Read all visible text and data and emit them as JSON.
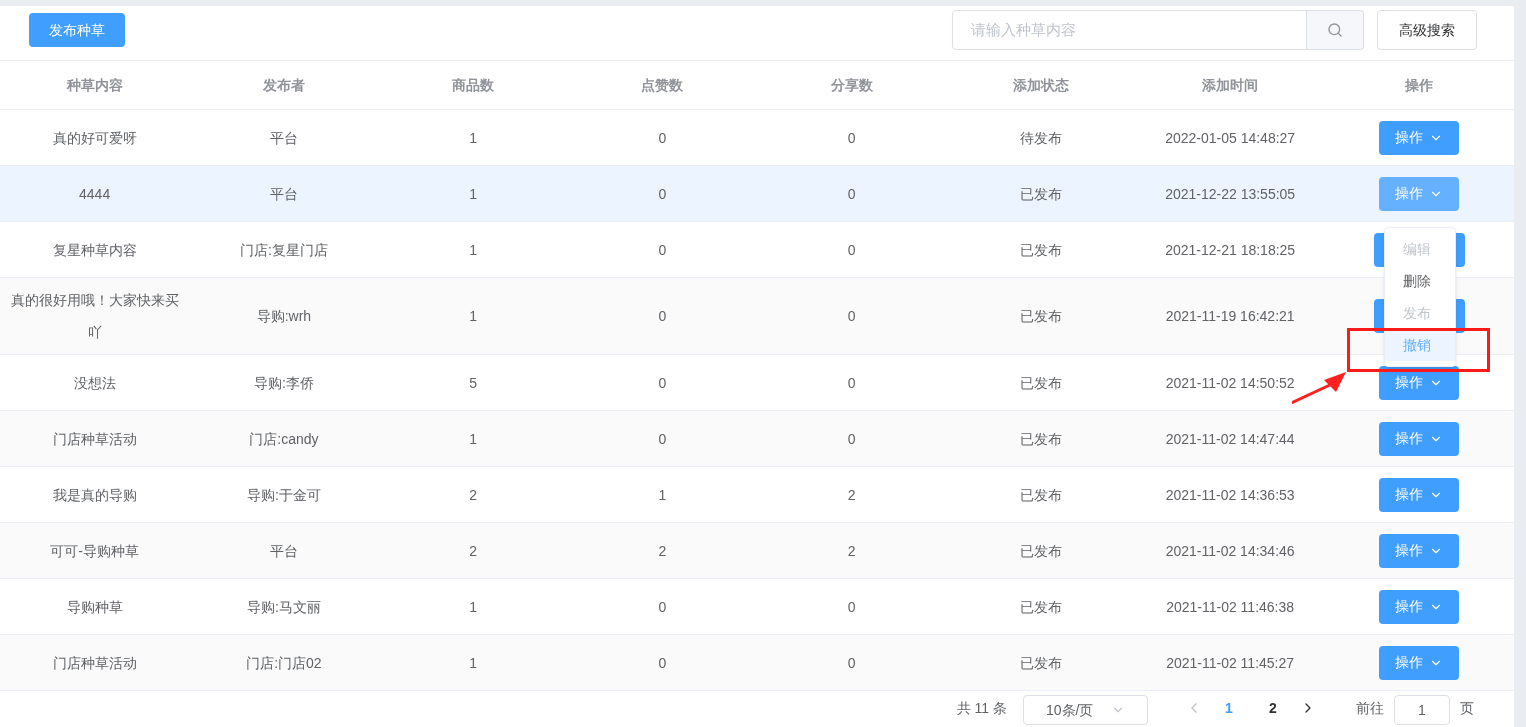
{
  "toolbar": {
    "publish_button": "发布种草",
    "search": {
      "placeholder": "请输入种草内容"
    },
    "advanced_button": "高级搜索"
  },
  "table": {
    "columns": [
      "种草内容",
      "发布者",
      "商品数",
      "点赞数",
      "分享数",
      "添加状态",
      "添加时间",
      "操作"
    ],
    "rows": [
      {
        "content": "真的好可爱呀",
        "publisher": "平台",
        "products": "1",
        "likes": "0",
        "shares": "0",
        "status": "待发布",
        "time": "2022-01-05 14:48:27",
        "action": "操作",
        "hovered": false
      },
      {
        "content": "4444",
        "publisher": "平台",
        "products": "1",
        "likes": "0",
        "shares": "0",
        "status": "已发布",
        "time": "2021-12-22 13:55:05",
        "action": "操作",
        "hovered": true
      },
      {
        "content": "复星种草内容",
        "publisher": "门店:复星门店",
        "products": "1",
        "likes": "0",
        "shares": "0",
        "status": "已发布",
        "time": "2021-12-21 18:18:25",
        "hovered": false
      },
      {
        "content": "真的很好用哦！大家快来买吖",
        "publisher": "导购:wrh",
        "products": "1",
        "likes": "0",
        "shares": "0",
        "status": "已发布",
        "time": "2021-11-19 16:42:21",
        "hovered": false
      },
      {
        "content": "没想法",
        "publisher": "导购:李侨",
        "products": "5",
        "likes": "0",
        "shares": "0",
        "status": "已发布",
        "time": "2021-11-02 14:50:52",
        "action": "操作",
        "hovered": false
      },
      {
        "content": "门店种草活动",
        "publisher": "门店:candy",
        "products": "1",
        "likes": "0",
        "shares": "0",
        "status": "已发布",
        "time": "2021-11-02 14:47:44",
        "action": "操作",
        "hovered": false
      },
      {
        "content": "我是真的导购",
        "publisher": "导购:于金可",
        "products": "2",
        "likes": "1",
        "shares": "2",
        "status": "已发布",
        "time": "2021-11-02 14:36:53",
        "action": "操作",
        "hovered": false
      },
      {
        "content": "可可-导购种草",
        "publisher": "平台",
        "products": "2",
        "likes": "2",
        "shares": "2",
        "status": "已发布",
        "time": "2021-11-02 14:34:46",
        "action": "操作",
        "hovered": false
      },
      {
        "content": "导购种草",
        "publisher": "导购:马文丽",
        "products": "1",
        "likes": "0",
        "shares": "0",
        "status": "已发布",
        "time": "2021-11-02 11:46:38",
        "action": "操作",
        "hovered": false
      },
      {
        "content": "门店种草活动",
        "publisher": "门店:门店02",
        "products": "1",
        "likes": "0",
        "shares": "0",
        "status": "已发布",
        "time": "2021-11-02 11:45:27",
        "action": "操作",
        "hovered": false
      }
    ]
  },
  "dropdown": {
    "items": [
      {
        "label": "编辑",
        "disabled": true,
        "selected": false
      },
      {
        "label": "删除",
        "disabled": false,
        "selected": false
      },
      {
        "label": "发布",
        "disabled": true,
        "selected": false
      },
      {
        "label": "撤销",
        "disabled": false,
        "selected": true
      }
    ]
  },
  "pagination": {
    "total": "共 11 条",
    "page_size": "10条/页",
    "pages": [
      {
        "label": "1",
        "selected": true
      },
      {
        "label": "2",
        "selected": false
      }
    ],
    "goto_label": "前往",
    "goto_value": "1",
    "goto_suffix": "页"
  }
}
